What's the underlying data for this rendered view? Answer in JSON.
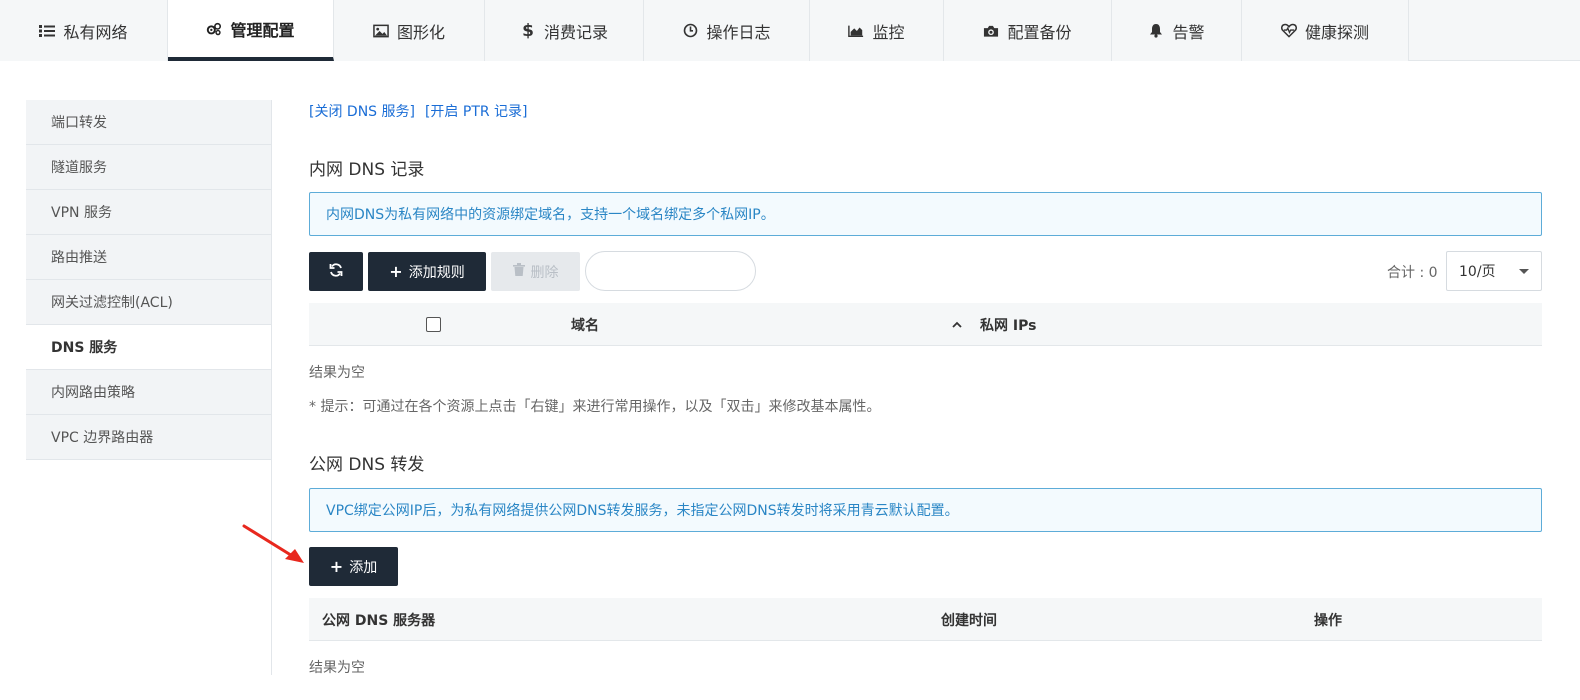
{
  "tabs": [
    {
      "label": "私有网络",
      "icon": "list-icon",
      "active": false
    },
    {
      "label": "管理配置",
      "icon": "gears-icon",
      "active": true
    },
    {
      "label": "图形化",
      "icon": "image-icon",
      "active": false
    },
    {
      "label": "消费记录",
      "icon": "dollar-icon",
      "active": false
    },
    {
      "label": "操作日志",
      "icon": "clock-icon",
      "active": false
    },
    {
      "label": "监控",
      "icon": "area-chart-icon",
      "active": false
    },
    {
      "label": "配置备份",
      "icon": "camera-icon",
      "active": false
    },
    {
      "label": "告警",
      "icon": "bell-icon",
      "active": false
    },
    {
      "label": "健康探测",
      "icon": "heartbeat-icon",
      "active": false
    }
  ],
  "sidebar": {
    "items": [
      {
        "label": "端口转发"
      },
      {
        "label": "隧道服务"
      },
      {
        "label": "VPN 服务"
      },
      {
        "label": "路由推送"
      },
      {
        "label": "网关过滤控制(ACL)"
      },
      {
        "label": "DNS 服务",
        "active": true
      },
      {
        "label": "内网路由策略"
      },
      {
        "label": "VPC 边界路由器"
      }
    ]
  },
  "toplinks": {
    "close_dns": "[关闭 DNS 服务]",
    "open_ptr": "[开启 PTR 记录]"
  },
  "private_dns": {
    "title": "内网 DNS 记录",
    "info": "内网DNS为私有网络中的资源绑定域名，支持一个域名绑定多个私网IP。",
    "add_rule_label": "添加规则",
    "delete_label": "删除",
    "total_label": "合计 : 0",
    "page_size": "10/页",
    "columns": {
      "domain": "域名",
      "ips": "私网 IPs"
    },
    "empty": "结果为空",
    "tip": "* 提示：可通过在各个资源上点击「右键」来进行常用操作，以及「双击」来修改基本属性。"
  },
  "public_dns": {
    "title": "公网 DNS 转发",
    "info": "VPC绑定公网IP后，为私有网络提供公网DNS转发服务，未指定公网DNS转发时将采用青云默认配置。",
    "add_label": "添加",
    "columns": {
      "server": "公网 DNS 服务器",
      "created": "创建时间",
      "actions": "操作"
    },
    "empty": "结果为空"
  },
  "colors": {
    "primary_dark": "#1f2a37",
    "link": "#1a6dd6",
    "info_border": "#5dacd8",
    "info_text": "#2a86c5",
    "annotation_arrow": "#e8281e"
  }
}
